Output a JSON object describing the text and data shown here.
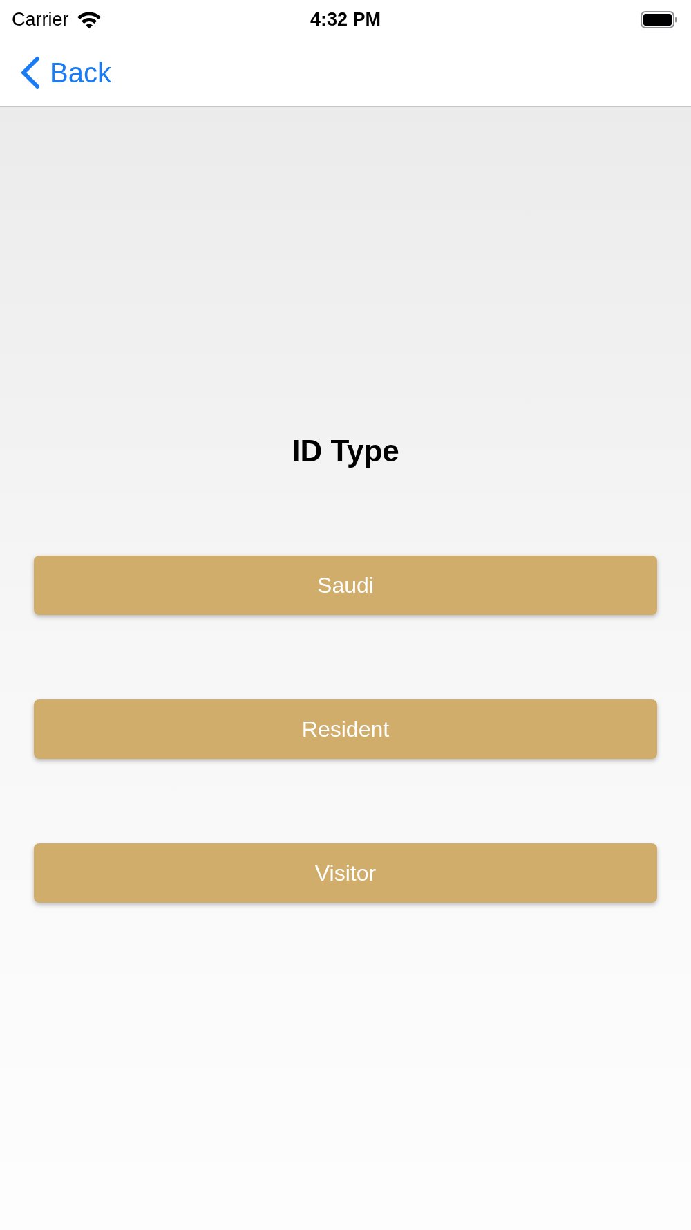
{
  "status_bar": {
    "carrier": "Carrier",
    "time": "4:32 PM"
  },
  "nav_bar": {
    "back": "Back"
  },
  "title": "ID Type",
  "options": [
    {
      "label": "Saudi"
    },
    {
      "label": "Resident"
    },
    {
      "label": "Visitor"
    }
  ]
}
